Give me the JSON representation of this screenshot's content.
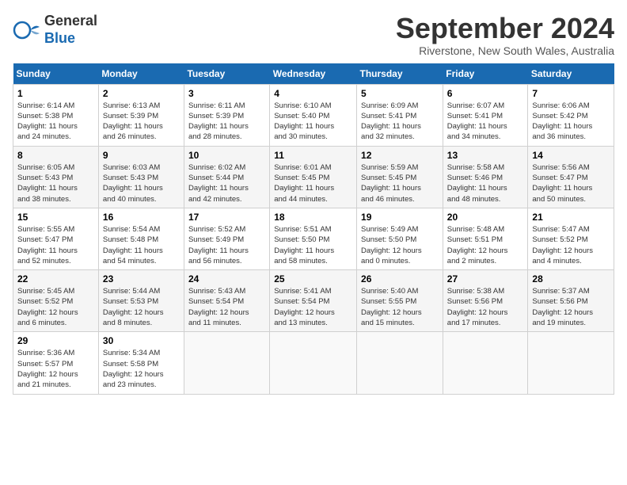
{
  "header": {
    "logo_line1": "General",
    "logo_line2": "Blue",
    "month_title": "September 2024",
    "subtitle": "Riverstone, New South Wales, Australia"
  },
  "days_of_week": [
    "Sunday",
    "Monday",
    "Tuesday",
    "Wednesday",
    "Thursday",
    "Friday",
    "Saturday"
  ],
  "weeks": [
    [
      {
        "day": "1",
        "info": "Sunrise: 6:14 AM\nSunset: 5:38 PM\nDaylight: 11 hours\nand 24 minutes."
      },
      {
        "day": "2",
        "info": "Sunrise: 6:13 AM\nSunset: 5:39 PM\nDaylight: 11 hours\nand 26 minutes."
      },
      {
        "day": "3",
        "info": "Sunrise: 6:11 AM\nSunset: 5:39 PM\nDaylight: 11 hours\nand 28 minutes."
      },
      {
        "day": "4",
        "info": "Sunrise: 6:10 AM\nSunset: 5:40 PM\nDaylight: 11 hours\nand 30 minutes."
      },
      {
        "day": "5",
        "info": "Sunrise: 6:09 AM\nSunset: 5:41 PM\nDaylight: 11 hours\nand 32 minutes."
      },
      {
        "day": "6",
        "info": "Sunrise: 6:07 AM\nSunset: 5:41 PM\nDaylight: 11 hours\nand 34 minutes."
      },
      {
        "day": "7",
        "info": "Sunrise: 6:06 AM\nSunset: 5:42 PM\nDaylight: 11 hours\nand 36 minutes."
      }
    ],
    [
      {
        "day": "8",
        "info": "Sunrise: 6:05 AM\nSunset: 5:43 PM\nDaylight: 11 hours\nand 38 minutes."
      },
      {
        "day": "9",
        "info": "Sunrise: 6:03 AM\nSunset: 5:43 PM\nDaylight: 11 hours\nand 40 minutes."
      },
      {
        "day": "10",
        "info": "Sunrise: 6:02 AM\nSunset: 5:44 PM\nDaylight: 11 hours\nand 42 minutes."
      },
      {
        "day": "11",
        "info": "Sunrise: 6:01 AM\nSunset: 5:45 PM\nDaylight: 11 hours\nand 44 minutes."
      },
      {
        "day": "12",
        "info": "Sunrise: 5:59 AM\nSunset: 5:45 PM\nDaylight: 11 hours\nand 46 minutes."
      },
      {
        "day": "13",
        "info": "Sunrise: 5:58 AM\nSunset: 5:46 PM\nDaylight: 11 hours\nand 48 minutes."
      },
      {
        "day": "14",
        "info": "Sunrise: 5:56 AM\nSunset: 5:47 PM\nDaylight: 11 hours\nand 50 minutes."
      }
    ],
    [
      {
        "day": "15",
        "info": "Sunrise: 5:55 AM\nSunset: 5:47 PM\nDaylight: 11 hours\nand 52 minutes."
      },
      {
        "day": "16",
        "info": "Sunrise: 5:54 AM\nSunset: 5:48 PM\nDaylight: 11 hours\nand 54 minutes."
      },
      {
        "day": "17",
        "info": "Sunrise: 5:52 AM\nSunset: 5:49 PM\nDaylight: 11 hours\nand 56 minutes."
      },
      {
        "day": "18",
        "info": "Sunrise: 5:51 AM\nSunset: 5:50 PM\nDaylight: 11 hours\nand 58 minutes."
      },
      {
        "day": "19",
        "info": "Sunrise: 5:49 AM\nSunset: 5:50 PM\nDaylight: 12 hours\nand 0 minutes."
      },
      {
        "day": "20",
        "info": "Sunrise: 5:48 AM\nSunset: 5:51 PM\nDaylight: 12 hours\nand 2 minutes."
      },
      {
        "day": "21",
        "info": "Sunrise: 5:47 AM\nSunset: 5:52 PM\nDaylight: 12 hours\nand 4 minutes."
      }
    ],
    [
      {
        "day": "22",
        "info": "Sunrise: 5:45 AM\nSunset: 5:52 PM\nDaylight: 12 hours\nand 6 minutes."
      },
      {
        "day": "23",
        "info": "Sunrise: 5:44 AM\nSunset: 5:53 PM\nDaylight: 12 hours\nand 8 minutes."
      },
      {
        "day": "24",
        "info": "Sunrise: 5:43 AM\nSunset: 5:54 PM\nDaylight: 12 hours\nand 11 minutes."
      },
      {
        "day": "25",
        "info": "Sunrise: 5:41 AM\nSunset: 5:54 PM\nDaylight: 12 hours\nand 13 minutes."
      },
      {
        "day": "26",
        "info": "Sunrise: 5:40 AM\nSunset: 5:55 PM\nDaylight: 12 hours\nand 15 minutes."
      },
      {
        "day": "27",
        "info": "Sunrise: 5:38 AM\nSunset: 5:56 PM\nDaylight: 12 hours\nand 17 minutes."
      },
      {
        "day": "28",
        "info": "Sunrise: 5:37 AM\nSunset: 5:56 PM\nDaylight: 12 hours\nand 19 minutes."
      }
    ],
    [
      {
        "day": "29",
        "info": "Sunrise: 5:36 AM\nSunset: 5:57 PM\nDaylight: 12 hours\nand 21 minutes."
      },
      {
        "day": "30",
        "info": "Sunrise: 5:34 AM\nSunset: 5:58 PM\nDaylight: 12 hours\nand 23 minutes."
      },
      null,
      null,
      null,
      null,
      null
    ]
  ]
}
